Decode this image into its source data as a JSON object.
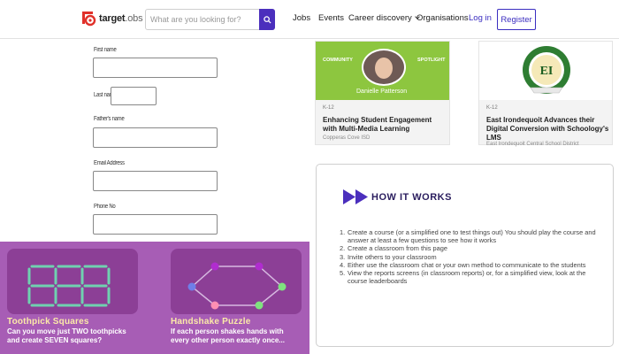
{
  "header": {
    "logo_text": "target",
    "logo_sub": ".obs",
    "search_placeholder": "What are you looking for?",
    "nav": [
      "Jobs",
      "Events",
      "Career discovery",
      "Organisations"
    ],
    "login": "Log in",
    "register": "Register"
  },
  "form": {
    "fields": [
      {
        "label": "First name",
        "value": ""
      },
      {
        "label": "Last name",
        "value": ""
      },
      {
        "label": "Father's name",
        "value": ""
      },
      {
        "label": "Email Address",
        "value": ""
      },
      {
        "label": "Phone No",
        "value": ""
      }
    ]
  },
  "puzzles": [
    {
      "title": "Toothpick Squares",
      "desc": "Can you move just TWO toothpicks and create SEVEN squares?"
    },
    {
      "title": "Handshake Puzzle",
      "desc": "If each person shakes hands with every other person exactly once..."
    }
  ],
  "spotlight": [
    {
      "banner_left": "COMMUNITY",
      "banner_right": "SPOTLIGHT",
      "person": "Danielle Patterson",
      "category": "K-12",
      "title": "Enhancing Student Engagement with Multi-Media Learning",
      "org": "Copperas Cove ISD",
      "banner_color": "#8dc63f"
    },
    {
      "category": "K-12",
      "title": "East Irondequoit Advances their Digital Conversion with Schoology's LMS",
      "org": "East Irondequoit Central School District",
      "seal_color": "#2e7d32",
      "seal_letters": "EI"
    }
  ],
  "how_it_works": {
    "title": "HOW IT WORKS",
    "icon_color": "#4b2fbd",
    "steps": [
      "Create a course (or a simplified one to test things out)   You should play the course and answer at least a few questions to see how it works",
      "Create a classroom from this page",
      "Invite others to your classroom",
      "Either use the classroom chat or your own method to communicate to the students",
      "View the reports screens (in classroom reports) or, for a simplified view, look at the course leaderboards"
    ]
  },
  "colors": {
    "brand": "#e0312a",
    "accent": "#3b2ec0",
    "puzzle_bg": "#a75db5",
    "puzzle_card": "#8c3f96",
    "puzzle_title": "#fbe9a8"
  }
}
